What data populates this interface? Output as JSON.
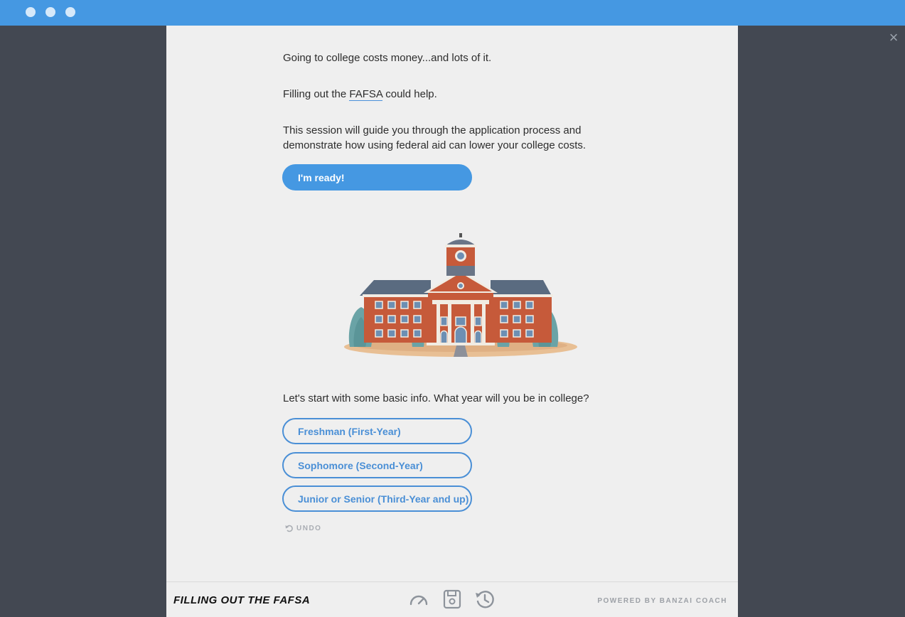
{
  "window": {
    "close_icon": "close-icon",
    "close_glyph": "×"
  },
  "intro": {
    "line1": "Going to college costs money...and lots of it.",
    "line2_prefix": "Filling out the ",
    "line2_link": "FAFSA",
    "line2_suffix": " could help.",
    "line3": "This session will guide you through the application process and demonstrate how using federal aid can lower your college costs."
  },
  "ready_button": {
    "label": "I'm ready!"
  },
  "illustration": {
    "icon": "college-building-illustration"
  },
  "question": {
    "prompt": "Let's start with some basic info. What year will you be in college?",
    "options": [
      "Freshman (First-Year)",
      "Sophomore (Second-Year)",
      "Junior or Senior (Third-Year and up)"
    ]
  },
  "undo": {
    "label": "UNDO",
    "icon": "undo-icon"
  },
  "footer": {
    "title": "FILLING OUT THE FAFSA",
    "icons": [
      "speedometer-icon",
      "save-icon",
      "history-icon"
    ],
    "powered_by": "POWERED BY BANZAI COACH"
  },
  "colors": {
    "accent": "#4598e2",
    "background_dark": "#434852",
    "panel": "#efefef"
  }
}
